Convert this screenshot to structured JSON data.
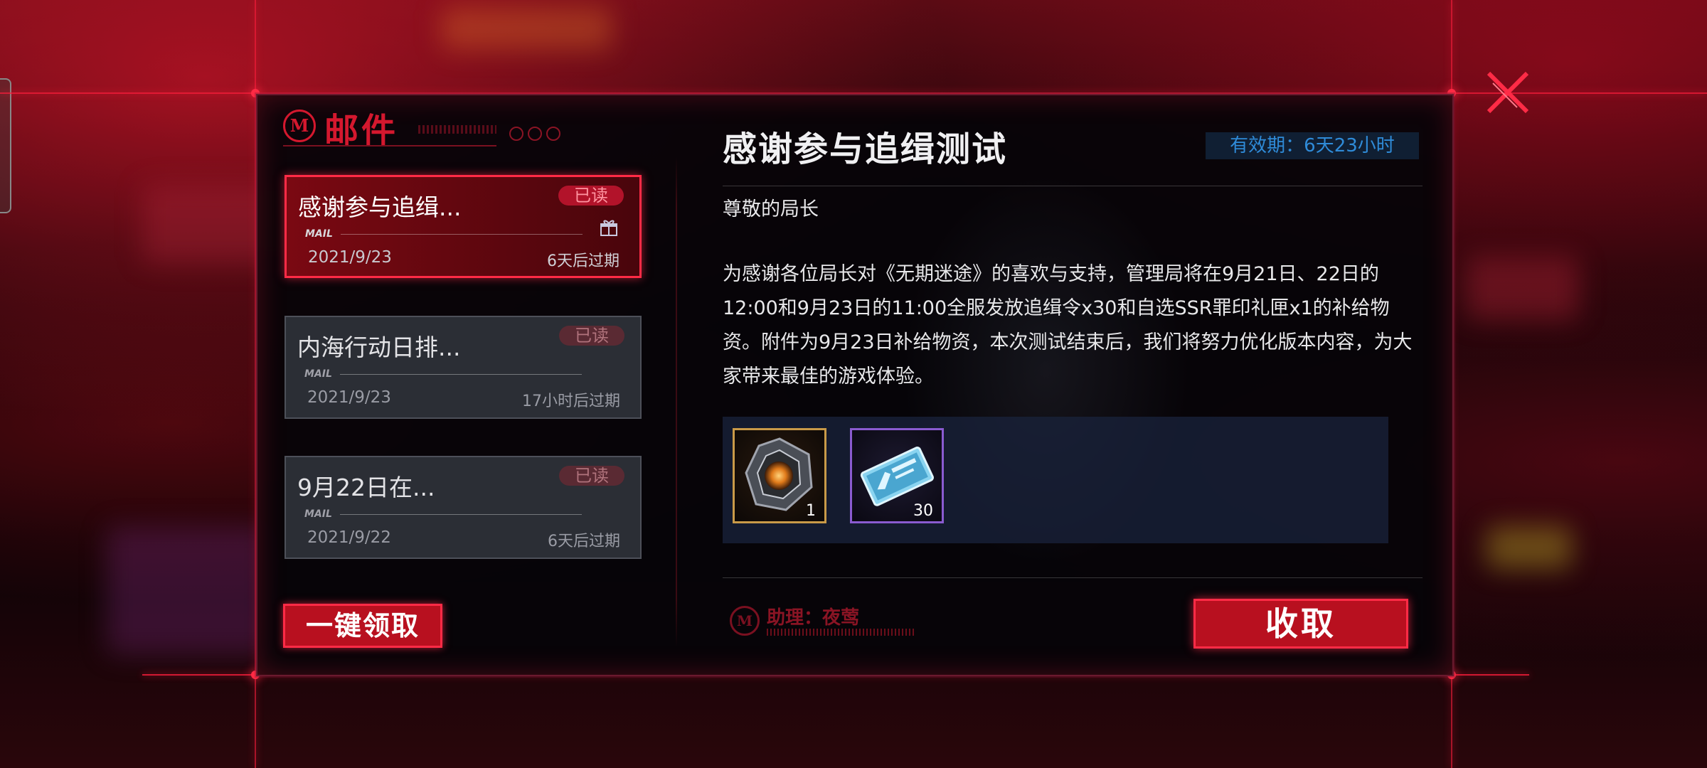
{
  "header": {
    "logo_letter": "M",
    "title": "邮件"
  },
  "mails": [
    {
      "title": "感谢参与追缉...",
      "badge": "已读",
      "label": "MAIL",
      "date": "2021/9/23",
      "expiry": "6天后过期",
      "state": "selected",
      "has_gift": true
    },
    {
      "title": "内海行动日排...",
      "badge": "已读",
      "label": "MAIL",
      "date": "2021/9/23",
      "expiry": "17小时后过期",
      "state": "read",
      "has_gift": false
    },
    {
      "title": "9月22日在...",
      "badge": "已读",
      "label": "MAIL",
      "date": "2021/9/22",
      "expiry": "6天后过期",
      "state": "read",
      "has_gift": false
    }
  ],
  "claim_all_label": "一键领取",
  "detail": {
    "title": "感谢参与追缉测试",
    "validity": "有效期：6天23小时",
    "greeting": "尊敬的局长",
    "body": "为感谢各位局长对《无期迷途》的喜欢与支持，管理局将在9月21日、22日的12:00和9月23日的11:00全服发放追缉令x30和自选SSR罪印礼匣x1的补给物资。附件为9月23日补给物资，本次测试结束后，我们将努力优化版本内容，为大家带来最佳的游戏体验。",
    "attachments": [
      {
        "icon": "gift-box-icon",
        "count": "1",
        "rarity_color": "#c99a48"
      },
      {
        "icon": "pursuit-ticket-icon",
        "count": "30",
        "rarity_color": "#8a5bd0"
      }
    ],
    "assistant": "助理：夜莺",
    "collect_label": "收取"
  },
  "colors": {
    "accent_red": "#ff2b46",
    "button_red": "#b8101f",
    "validity_blue": "#2f8bd8"
  }
}
